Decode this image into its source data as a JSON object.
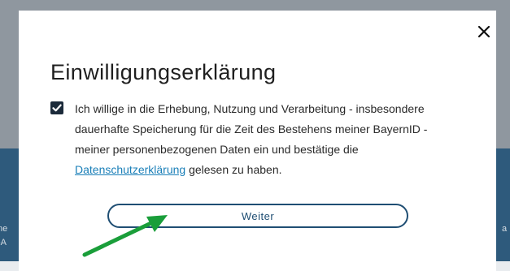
{
  "background": {
    "left_text_1": "ne",
    "left_text_2": "-A",
    "right_text_1": "a"
  },
  "modal": {
    "title": "Einwilligungserklärung",
    "close_label": "×",
    "consent": {
      "checked": true,
      "text_before_link": "Ich willige in die Erhebung, Nutzung und Verarbeitung - insbesondere dauerhafte Speicherung für die Zeit des Bestehens meiner BayernID - meiner personenbezogenen Daten ein und bestätige die ",
      "link_text": "Datenschutzerklärung",
      "text_after_link": " gelesen zu haben."
    },
    "continue_button": "Weiter"
  },
  "colors": {
    "accent": "#1f4e73",
    "link": "#1a7fb8",
    "annotation_arrow": "#1a9e3a"
  },
  "icons": [
    "close-icon",
    "checkmark-icon",
    "annotation-arrow-icon"
  ]
}
